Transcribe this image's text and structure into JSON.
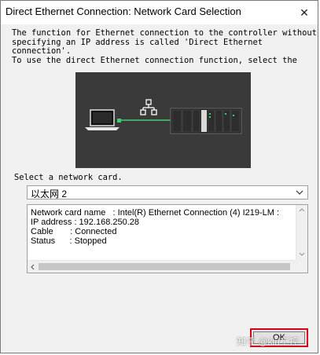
{
  "window": {
    "title": "Direct Ethernet Connection: Network Card Selection",
    "close_glyph": "✕"
  },
  "description": {
    "lines": [
      "The function for Ethernet connection to the controller without",
      "specifying an IP address is called 'Direct Ethernet",
      "connection'.",
      "To use the direct Ethernet connection function, select the"
    ]
  },
  "diagram": {
    "icons": [
      "laptop-icon",
      "network-icon",
      "controller-icon"
    ],
    "link_color": "#3fcf6e"
  },
  "network_card": {
    "label": "Select a network card.",
    "selected": "以太网 2"
  },
  "info": {
    "lines": [
      "Network card name   : Intel(R) Ethernet Connection (4) I219-LM : ",
      "IP address : 192.168.250.28",
      "Cable       : Connected",
      "Status      : Stopped"
    ]
  },
  "buttons": {
    "ok_label": "OK",
    "ok_highlight_color": "#d4001a"
  },
  "watermark": {
    "text": "知乎 @kiri工控"
  }
}
